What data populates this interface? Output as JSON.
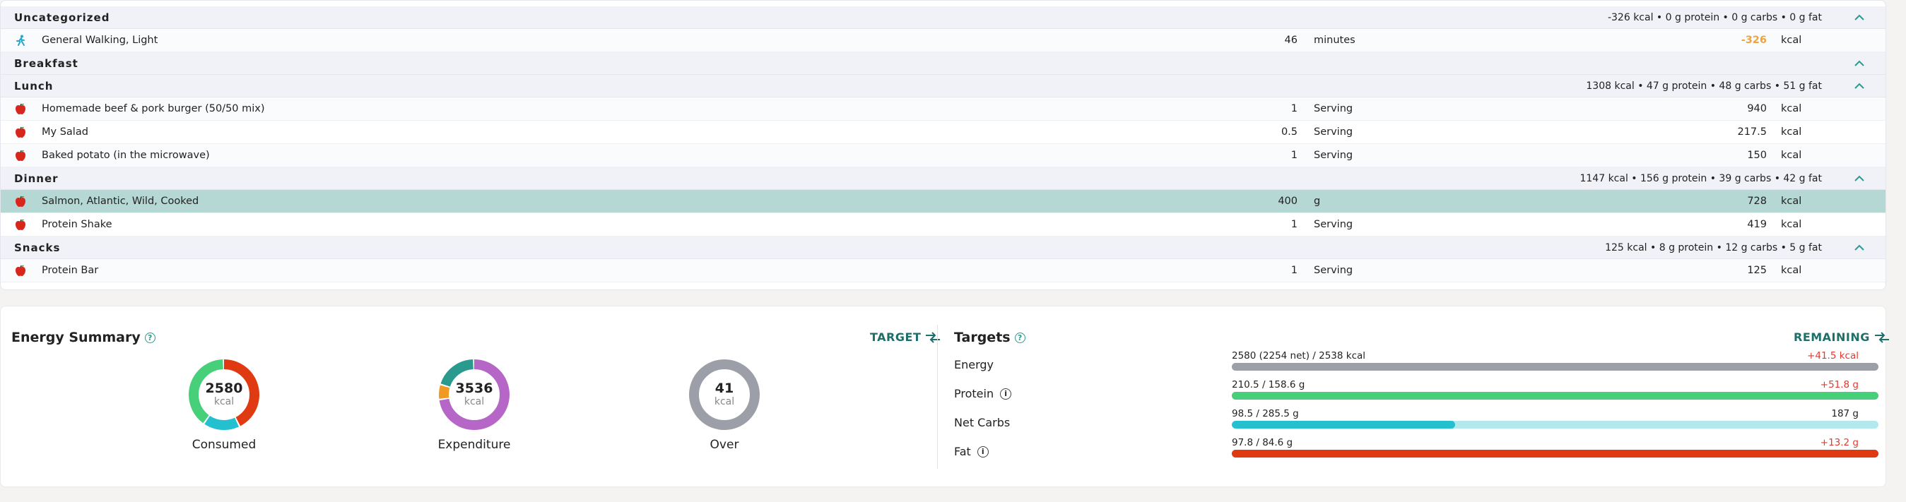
{
  "diary": {
    "groups": [
      {
        "name": "Uncategorized",
        "summary": "-326 kcal • 0 g protein • 0 g carbs • 0 g fat",
        "items": [
          {
            "name": "General Walking, Light",
            "amount": "46",
            "unit": "minutes",
            "value": "-326",
            "vunit": "kcal",
            "icon": "walking-icon",
            "negative": true
          }
        ]
      },
      {
        "name": "Breakfast",
        "summary": "",
        "items": []
      },
      {
        "name": "Lunch",
        "summary": "1308 kcal • 47 g protein • 48 g carbs • 51 g fat",
        "items": [
          {
            "name": "Homemade beef & pork burger (50/50 mix)",
            "amount": "1",
            "unit": "Serving",
            "value": "940",
            "vunit": "kcal",
            "icon": "apple-icon"
          },
          {
            "name": "My Salad",
            "amount": "0.5",
            "unit": "Serving",
            "value": "217.5",
            "vunit": "kcal",
            "icon": "apple-icon"
          },
          {
            "name": "Baked potato (in the microwave)",
            "amount": "1",
            "unit": "Serving",
            "value": "150",
            "vunit": "kcal",
            "icon": "apple-icon"
          }
        ]
      },
      {
        "name": "Dinner",
        "summary": "1147 kcal • 156 g protein • 39 g carbs • 42 g fat",
        "items": [
          {
            "name": "Salmon, Atlantic, Wild, Cooked",
            "amount": "400",
            "unit": "g",
            "value": "728",
            "vunit": "kcal",
            "icon": "apple-icon",
            "selected": true
          },
          {
            "name": "Protein Shake",
            "amount": "1",
            "unit": "Serving",
            "value": "419",
            "vunit": "kcal",
            "icon": "apple-icon"
          }
        ]
      },
      {
        "name": "Snacks",
        "summary": "125 kcal • 8 g protein • 12 g carbs • 5 g fat",
        "items": [
          {
            "name": "Protein Bar",
            "amount": "1",
            "unit": "Serving",
            "value": "125",
            "vunit": "kcal",
            "icon": "apple-icon"
          }
        ]
      }
    ]
  },
  "energy_summary": {
    "title": "Energy Summary",
    "help": "?",
    "toggle_label": "TARGET",
    "donuts": [
      {
        "value": "2580",
        "unit": "kcal",
        "label": "Consumed",
        "segments": [
          {
            "color": "#e03a12",
            "fraction": 0.43
          },
          {
            "color": "#25c0d0",
            "fraction": 0.17
          },
          {
            "color": "#47cf7a",
            "fraction": 0.4
          }
        ]
      },
      {
        "value": "3536",
        "unit": "kcal",
        "label": "Expenditure",
        "segments": [
          {
            "color": "#b566c6",
            "fraction": 0.73
          },
          {
            "color": "#f19a23",
            "fraction": 0.07
          },
          {
            "color": "#2a9a8f",
            "fraction": 0.2
          }
        ]
      },
      {
        "value": "41",
        "unit": "kcal",
        "label": "Over",
        "segments": [
          {
            "color": "#9c9ea8",
            "fraction": 1.0
          }
        ]
      }
    ]
  },
  "targets": {
    "title": "Targets",
    "help": "?",
    "toggle_label": "REMAINING",
    "rows": [
      {
        "label": "Energy",
        "info": false,
        "text": "2580 (2254 net) / 2538 kcal",
        "remaining": "+41.5 kcal",
        "remaining_color": "#e23a2e",
        "fill": 1.0,
        "fill_color": "#9c9ea8",
        "track_color": "#9c9ea8"
      },
      {
        "label": "Protein",
        "info": true,
        "text": "210.5 / 158.6 g",
        "remaining": "+51.8 g",
        "remaining_color": "#e23a2e",
        "fill": 1.0,
        "fill_color": "#47cf7a",
        "track_color": "#47cf7a"
      },
      {
        "label": "Net Carbs",
        "info": false,
        "text": "98.5 / 285.5 g",
        "remaining": "187 g",
        "remaining_color": "#222222",
        "fill": 0.345,
        "fill_color": "#25c0d0",
        "track_color": "#b2e8ee"
      },
      {
        "label": "Fat",
        "info": true,
        "text": "97.8 / 84.6 g",
        "remaining": "+13.2 g",
        "remaining_color": "#e23a2e",
        "fill": 1.0,
        "fill_color": "#e03a12",
        "track_color": "#e03a12"
      }
    ]
  }
}
